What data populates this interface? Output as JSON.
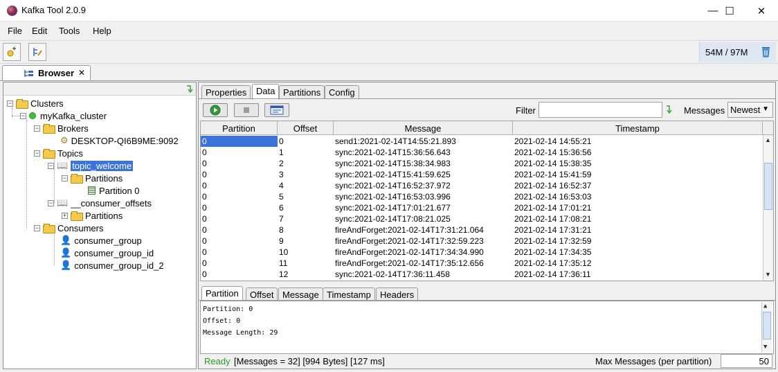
{
  "window": {
    "title": "Kafka Tool  2.0.9",
    "minimize": "—",
    "maximize": "☐",
    "close": "✕"
  },
  "menu": [
    "File",
    "Edit",
    "Tools",
    "Help"
  ],
  "toolbar": {
    "memory_used": "54M",
    "memory_total": " / 97M",
    "icons": [
      "new-connection-icon",
      "edit-connection-icon",
      "trash-icon"
    ]
  },
  "browser_tab": {
    "label": "Browser",
    "close": "✕"
  },
  "tree": {
    "clusters": "Clusters",
    "cluster_name": "myKafka_cluster",
    "brokers": "Brokers",
    "broker": "DESKTOP-QI6B9ME:9092",
    "topics": "Topics",
    "topic1": "topic_welcome",
    "partitions1": "Partitions",
    "partition0": "Partition 0",
    "topic2": "__consumer_offsets",
    "partitions2": "Partitions",
    "consumers": "Consumers",
    "consumer_groups": [
      "consumer_group",
      "consumer_group_id",
      "consumer_group_id_2"
    ]
  },
  "right_tabs": [
    "Properties",
    "Data",
    "Partitions",
    "Config"
  ],
  "active_right_tab": "Data",
  "filter": {
    "label": "Filter",
    "value": ""
  },
  "messages_select": {
    "label": "Messages",
    "value": "Newest"
  },
  "table": {
    "columns": [
      "Partition",
      "Offset",
      "Message",
      "Timestamp"
    ],
    "rows": [
      [
        "0",
        "0",
        "send1:2021-02-14T14:55:21.893",
        "2021-02-14 14:55:21"
      ],
      [
        "0",
        "1",
        "sync:2021-02-14T15:36:56.643",
        "2021-02-14 15:36:56"
      ],
      [
        "0",
        "2",
        "sync:2021-02-14T15:38:34.983",
        "2021-02-14 15:38:35"
      ],
      [
        "0",
        "3",
        "sync:2021-02-14T15:41:59.625",
        "2021-02-14 15:41:59"
      ],
      [
        "0",
        "4",
        "sync:2021-02-14T16:52:37.972",
        "2021-02-14 16:52:37"
      ],
      [
        "0",
        "5",
        "sync:2021-02-14T16:53:03.996",
        "2021-02-14 16:53:03"
      ],
      [
        "0",
        "6",
        "sync:2021-02-14T17:01:21.677",
        "2021-02-14 17:01:21"
      ],
      [
        "0",
        "7",
        "sync:2021-02-14T17:08:21.025",
        "2021-02-14 17:08:21"
      ],
      [
        "0",
        "8",
        "fireAndForget:2021-02-14T17:31:21.064",
        "2021-02-14 17:31:21"
      ],
      [
        "0",
        "9",
        "fireAndForget:2021-02-14T17:32:59.223",
        "2021-02-14 17:32:59"
      ],
      [
        "0",
        "10",
        "fireAndForget:2021-02-14T17:34:34.990",
        "2021-02-14 17:34:35"
      ],
      [
        "0",
        "11",
        "fireAndForget:2021-02-14T17:35:12.656",
        "2021-02-14 17:35:12"
      ],
      [
        "0",
        "12",
        "sync:2021-02-14T17:36:11.458",
        "2021-02-14 17:36:11"
      ]
    ]
  },
  "detail_tabs": [
    "Partition",
    "Offset",
    "Message",
    "Timestamp",
    "Headers"
  ],
  "detail": {
    "line1": "Partition: 0",
    "line2": "Offset: 0",
    "line3": "Message Length: 29"
  },
  "status": {
    "ready": "Ready",
    "info": "[Messages = 32]  [994 Bytes]  [127 ms]",
    "max_label": "Max Messages (per partition)",
    "max_value": "50"
  },
  "colors": {
    "selection": "#3b73d9",
    "ready": "#2a9a2a",
    "memory_bg": "#dde8f3"
  }
}
